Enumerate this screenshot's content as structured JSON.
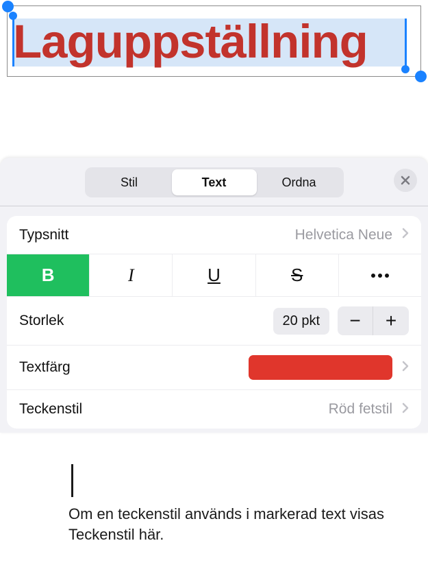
{
  "textbox": {
    "content": "Laguppställning"
  },
  "panel": {
    "tabs": {
      "style": "Stil",
      "text": "Text",
      "arrange": "Ordna"
    },
    "font": {
      "label": "Typsnitt",
      "value": "Helvetica Neue"
    },
    "styleButtons": {
      "bold": "B",
      "italic": "I",
      "underline": "U",
      "strike": "S"
    },
    "size": {
      "label": "Storlek",
      "value": "20 pkt",
      "minus": "−",
      "plus": "+"
    },
    "textColor": {
      "label": "Textfärg",
      "color": "#e0362c"
    },
    "charStyle": {
      "label": "Teckenstil",
      "value": "Röd fetstil"
    }
  },
  "callout": "Om en teckenstil används i markerad text visas Teckenstil här."
}
